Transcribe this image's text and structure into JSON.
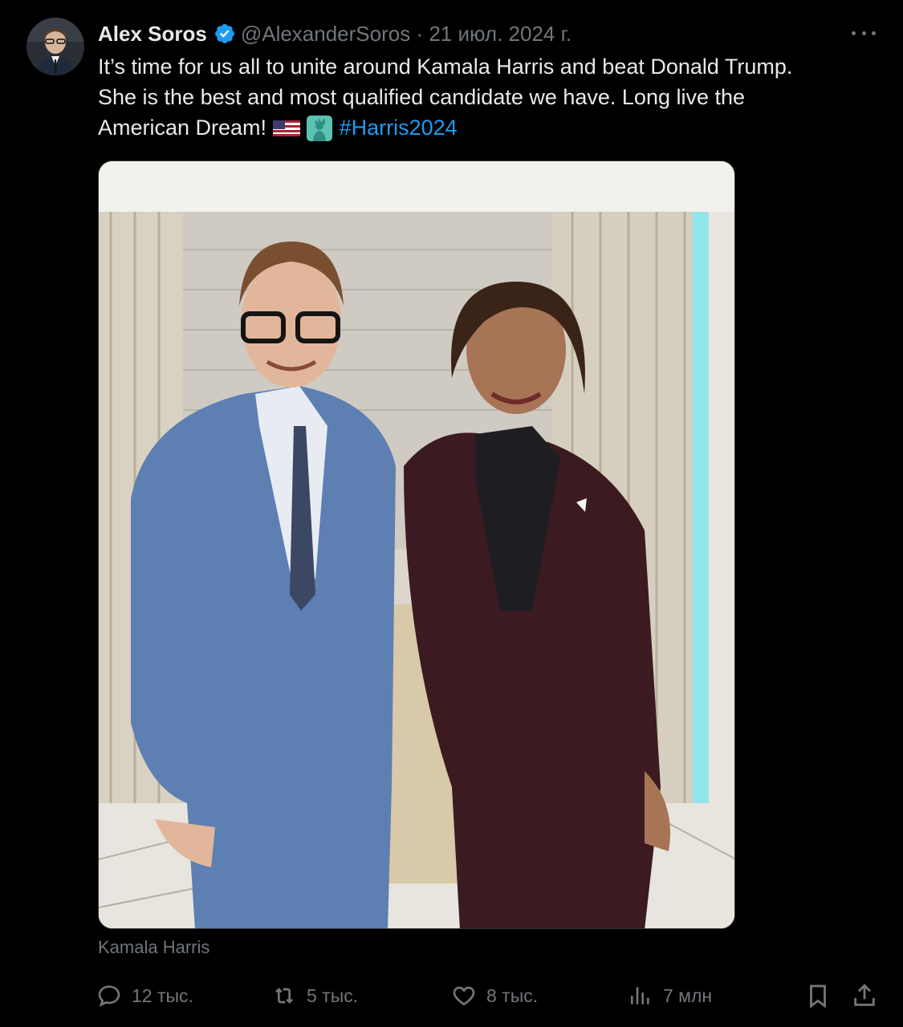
{
  "author": {
    "name": "Alex Soros",
    "handle": "@AlexanderSoros",
    "separator": " · ",
    "date": "21 июл. 2024 г."
  },
  "tweet": {
    "line1": "It’s time for us all to unite around Kamala Harris and beat Donald Trump.",
    "line2": "She is the best and most qualified candidate we have. Long live the",
    "line3_text": "American Dream!",
    "hashtag": "#Harris2024",
    "emojis": [
      "us-flag-icon",
      "statue-of-liberty-icon"
    ]
  },
  "media": {
    "caption": "Kamala Harris"
  },
  "actions": {
    "replies": "12 тыс.",
    "reposts": "5 тыс.",
    "likes": "8 тыс.",
    "views": "7 млн"
  },
  "colors": {
    "background": "#000000",
    "text": "#e7e9ea",
    "muted": "#71767b",
    "link": "#1d9bf0",
    "verified": "#1d9bf0"
  }
}
